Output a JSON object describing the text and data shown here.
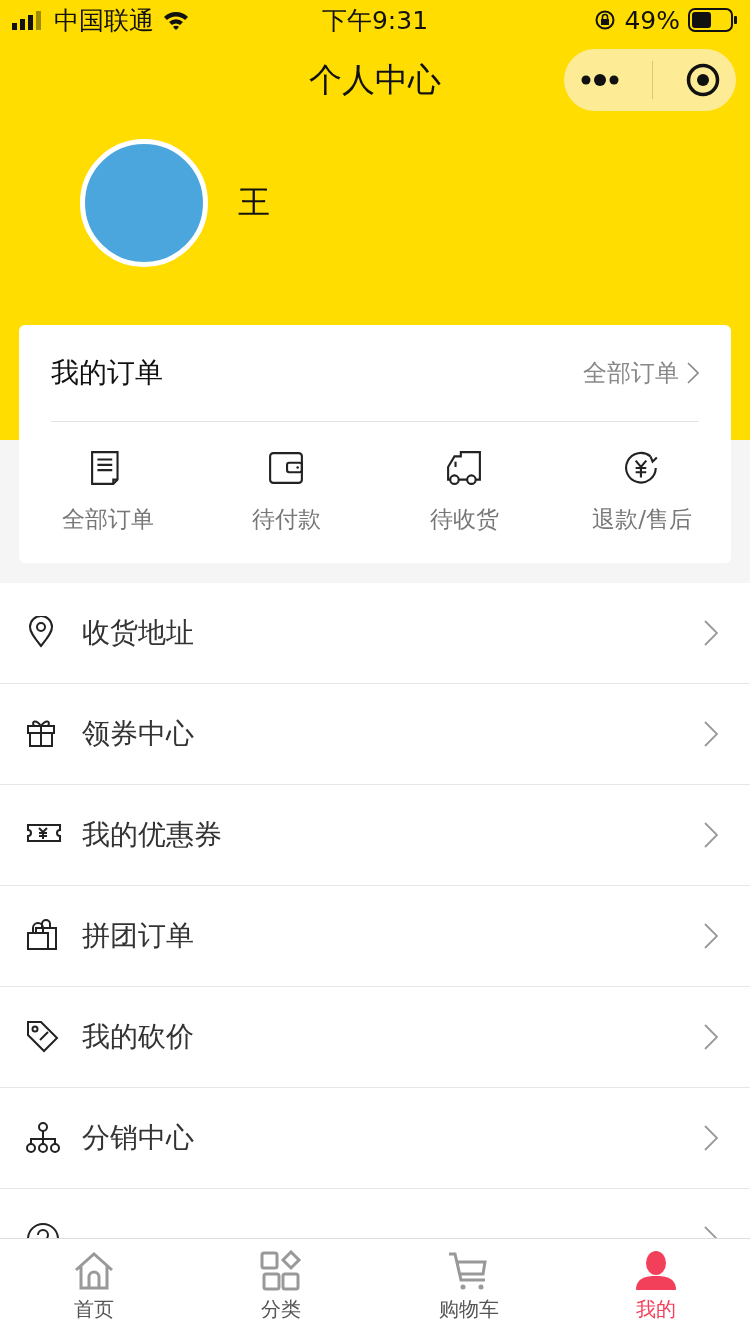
{
  "status_bar": {
    "carrier": "中国联通",
    "time": "下午9:31",
    "battery_percent": "49%"
  },
  "nav": {
    "title": "个人中心"
  },
  "profile": {
    "name": "王"
  },
  "orders": {
    "title": "我的订单",
    "all_link": "全部订单",
    "items": [
      {
        "kind": "document",
        "label": "全部订单"
      },
      {
        "kind": "wallet",
        "label": "待付款"
      },
      {
        "kind": "truck",
        "label": "待收货"
      },
      {
        "kind": "refund",
        "label": "退款/售后"
      }
    ]
  },
  "menu": [
    {
      "kind": "location",
      "label": "收货地址"
    },
    {
      "kind": "gift",
      "label": "领券中心"
    },
    {
      "kind": "ticket",
      "label": "我的优惠券"
    },
    {
      "kind": "bags",
      "label": "拼团订单"
    },
    {
      "kind": "tag",
      "label": "我的砍价"
    },
    {
      "kind": "network",
      "label": "分销中心"
    },
    {
      "kind": "help"
    }
  ],
  "tab_bar": [
    {
      "kind": "home",
      "label": "首页",
      "selected": false
    },
    {
      "kind": "category",
      "label": "分类",
      "selected": false
    },
    {
      "kind": "cart",
      "label": "购物车",
      "selected": false
    },
    {
      "kind": "person",
      "label": "我的",
      "selected": true
    }
  ]
}
